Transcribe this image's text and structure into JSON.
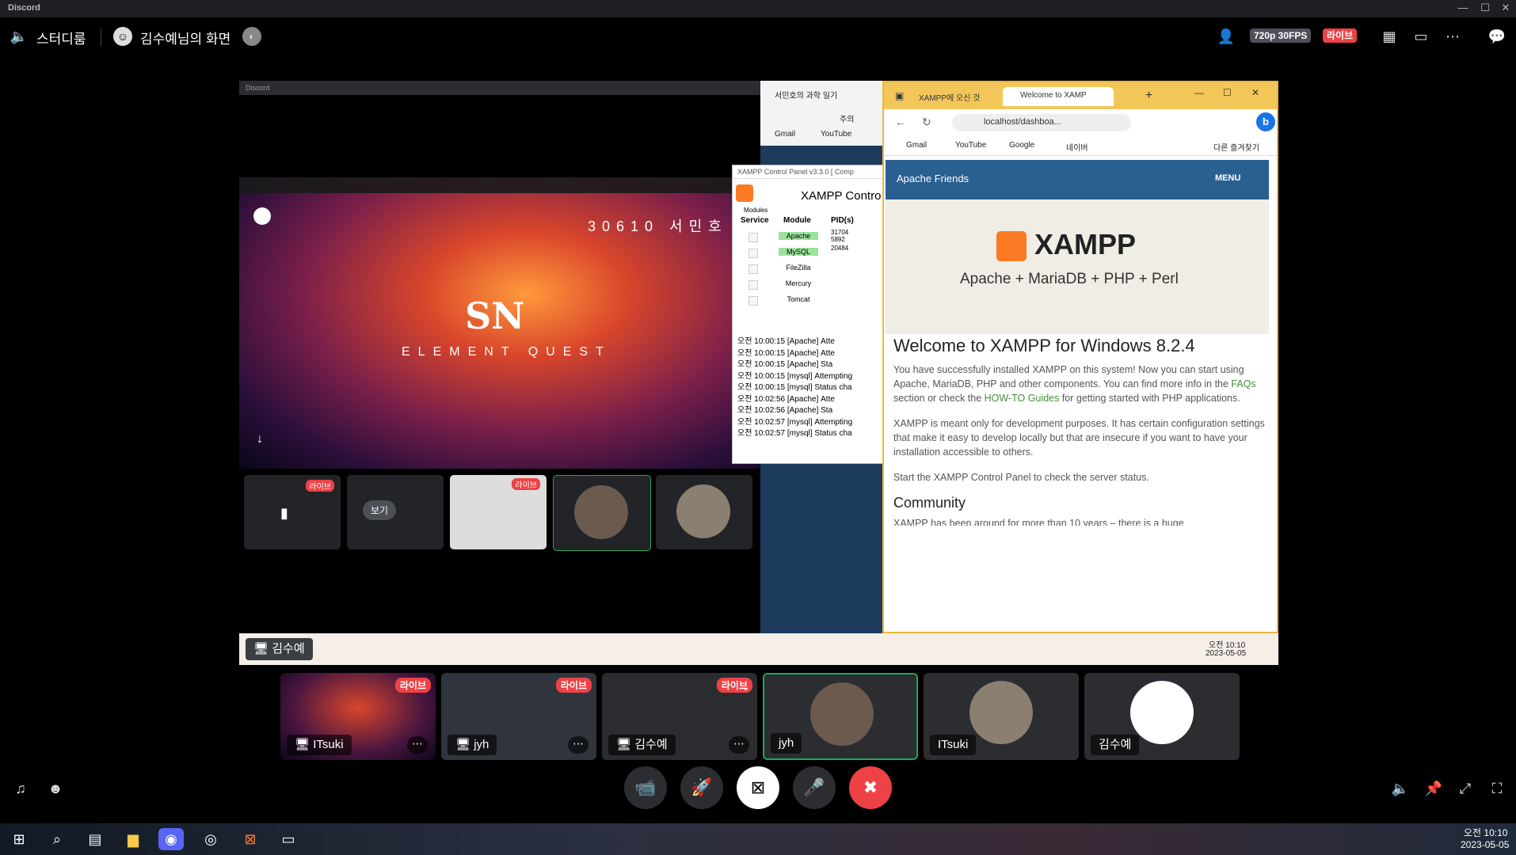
{
  "window": {
    "app_name": "Discord",
    "minimize": "—",
    "maximize": "☐",
    "close": "✕"
  },
  "header": {
    "channel_name": "스터디룸",
    "stream_title": "김수예님의 화면",
    "quality": "720p 30FPS",
    "live_badge": "라이브"
  },
  "shared_screen": {
    "inner_discord_title": "Discord",
    "slide_title": "30610 서민호",
    "slide_logo": "SN",
    "slide_subtitle": "ELEMENT QUEST",
    "inner_live": "라이브",
    "inner_watch": "보기",
    "chrome_tab": "서민호의 과학 일기",
    "chrome_addr": "주의",
    "chrome_bm": [
      "Gmail",
      "YouTube"
    ],
    "xampp_title": "XAMPP Control Panel v3.3.0   [ Comp",
    "xampp_heading": "XAMPP Contro",
    "xampp_headers": [
      "Modules",
      "Service",
      "Module",
      "PID(s)"
    ],
    "xampp_modules": [
      {
        "name": "Apache",
        "pid": "31704\n5892",
        "on": true
      },
      {
        "name": "MySQL",
        "pid": "20484",
        "on": true
      },
      {
        "name": "FileZilla",
        "pid": "",
        "on": false
      },
      {
        "name": "Mercury",
        "pid": "",
        "on": false
      },
      {
        "name": "Tomcat",
        "pid": "",
        "on": false
      }
    ],
    "xampp_log": [
      "오전 10:00:15  [Apache]    Atte",
      "오전 10:00:15  [Apache]    Atte",
      "오전 10:00:15  [Apache]    Sta",
      "오전 10:00:15  [mysql]   Attempting",
      "오전 10:00:15  [mysql]   Status cha",
      "오전 10:02:56  [Apache]    Atte",
      "오전 10:02:56  [Apache]    Sta",
      "오전 10:02:57  [mysql]   Attempting",
      "오전 10:02:57  [mysql]   Status cha"
    ],
    "edge_tab1": "XAMPP에 오신 것",
    "edge_tab2": "Welcome to XAMP",
    "edge_url": "localhost/dashboa...",
    "edge_bookmarks": [
      "Gmail",
      "YouTube",
      "Google",
      "네이버"
    ],
    "edge_other_bookmarks": "다른 즐겨찾기",
    "apache_friends": "Apache Friends",
    "menu": "MENU",
    "xampp_logo_text": "XAMPP",
    "xampp_tagline": "Apache + MariaDB + PHP + Perl",
    "welcome_heading": "Welcome to XAMPP for Windows 8.2.4",
    "para1_a": "You have successfully installed XAMPP on this system! Now you can start using Apache, MariaDB, PHP and other components. You can find more info in the ",
    "para1_link1": "FAQs",
    "para1_b": " section or check the ",
    "para1_link2": "HOW-TO Guides",
    "para1_c": " for getting started with PHP applications.",
    "para2": "XAMPP is meant only for development purposes. It has certain configuration settings that make it easy to develop locally but that are insecure if you want to have your installation accessible to others.",
    "para3": "Start the XAMPP Control Panel to check the server status.",
    "community": "Community",
    "community_text": "XAMPP has been around for more than 10 years – there is a huge",
    "inner_taskbar_label": "김수예",
    "inner_time": "오전 10:10",
    "inner_date": "2023-05-05"
  },
  "participants": [
    {
      "label": "ITsuki",
      "live": "라이브",
      "kind": "stream"
    },
    {
      "label": "jyh",
      "live": "라이브",
      "kind": "stream"
    },
    {
      "label": "김수예",
      "live": "라이브",
      "kind": "stream"
    },
    {
      "label": "jyh",
      "kind": "avatar"
    },
    {
      "label": "ITsuki",
      "kind": "avatar"
    },
    {
      "label": "김수예",
      "kind": "avatar"
    }
  ],
  "taskbar": {
    "time": "오전 10:10",
    "date": "2023-05-05"
  },
  "colors": {
    "live": "#ed4245",
    "speaking": "#23a55a",
    "xampp_orange": "#fb7a24",
    "xampp_blue": "#2a5f91"
  }
}
